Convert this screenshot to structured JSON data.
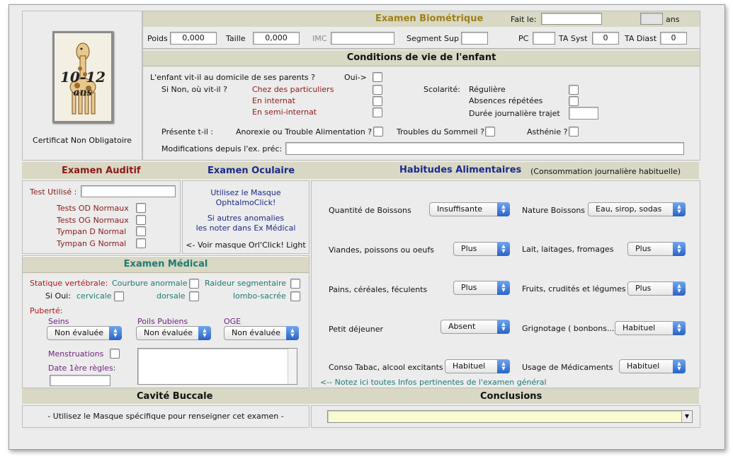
{
  "logo": {
    "age_text": "10-12",
    "ans_text": "ans"
  },
  "certificat": "Certificat Non Obligatoire",
  "biometrique": {
    "title": "Examen Biométrique",
    "fait_le_label": "Fait le:",
    "fait_le_value": "",
    "ans_value": "",
    "ans_label": "ans",
    "poids_label": "Poids",
    "poids_value": "0,000",
    "taille_label": "Taille",
    "taille_value": "0,000",
    "imc_label": "IMC",
    "imc_value": "",
    "segment_label": "Segment Sup",
    "segment_value": "",
    "pc_label": "PC",
    "pc_value": "",
    "ta_syst_label": "TA Syst",
    "ta_syst_value": "0",
    "ta_diast_label": "TA Diast",
    "ta_diast_value": "0"
  },
  "conditions": {
    "title": "Conditions de vie de l'enfant",
    "q_domicile": "L'enfant vit-il au domicile de ses parents ?",
    "oui": "Oui->",
    "si_non": "Si Non, où vit-il ?",
    "lieux": [
      "Chez des particuliers",
      "En internat",
      "En semi-internat"
    ],
    "scolarite_label": "Scolarité:",
    "scolarite": [
      "Régulière",
      "Absences répétées",
      "Durée journalière trajet"
    ],
    "presente_label": "Présente t-il :",
    "anorexie": "Anorexie ou Trouble Alimentation ?",
    "sommeil": "Troubles du Sommeil ?",
    "asthenie": "Asthénie ?",
    "modifs_label": "Modifications depuis l'ex. préc:"
  },
  "auditif": {
    "title": "Examen Auditif",
    "test_label": "Test Utilisé :",
    "items": [
      "Tests OD Normaux",
      "Tests OG Normaux",
      "Tympan D Normal",
      "Tympan G Normal"
    ]
  },
  "oculaire": {
    "title": "Examen Oculaire",
    "line1": "Utilisez le Masque",
    "line2": "OphtalmoClick!",
    "line3": "Si autres anomalies",
    "line4": "les noter dans Ex Médical",
    "line5": "<- Voir masque Orl'Click! Light"
  },
  "medical": {
    "title": "Examen Médical",
    "statique": "Statique vertébrale:",
    "courbure": "Courbure anormale",
    "raideur": "Raideur segmentaire",
    "si_oui": "Si Oui:",
    "cervicale": "cervicale",
    "dorsale": "dorsale",
    "lombo": "lombo-sacrée",
    "puberte": "Puberté:",
    "seins": "Seins",
    "poils": "Poils Pubiens",
    "oge": "OGE",
    "seins_value": "Non évaluée",
    "poils_value": "Non évaluée",
    "oge_value": "Non évaluée",
    "menstruations": "Menstruations",
    "date_regles": "Date 1ère règles:"
  },
  "habitudes": {
    "title": "Habitudes Alimentaires",
    "subtitle": "(Consommation journalière habituelle)",
    "boissons_label": "Quantité de Boissons",
    "boissons_value": "Insuffisante",
    "nature_label": "Nature Boissons",
    "nature_value": "Eau, sirop, sodas",
    "viandes_label": "Viandes, poissons ou oeufs",
    "viandes_value": "Plus",
    "lait_label": "Lait, laitages, fromages",
    "lait_value": "Plus",
    "pains_label": "Pains, céréales, féculents",
    "pains_value": "Plus",
    "fruits_label": "Fruits, crudités et légumes",
    "fruits_value": "Plus",
    "petit_label": "Petit déjeuner",
    "petit_value": "Absent",
    "grignotage_label": "Grignotage ( bonbons...)",
    "grignotage_value": "Habituel",
    "tabac_label": "Conso Tabac, alcool excitants",
    "tabac_value": "Habituel",
    "medic_label": "Usage de Médicaments",
    "medic_value": "Habituel",
    "note": "<-- Notez ici toutes Infos pertinentes de l'examen général"
  },
  "cavite": {
    "title": "Cavité Buccale",
    "text": "- Utilisez le Masque spécifique pour renseigner cet examen -"
  },
  "conclusions": {
    "title": "Conclusions",
    "value": ""
  },
  "colors": {
    "header_bg": "#d9d8c4",
    "dark_red": "#8b1a1a",
    "navy": "#1a2a8b",
    "teal": "#1f7a72",
    "select_blue": "#2a63c8"
  }
}
